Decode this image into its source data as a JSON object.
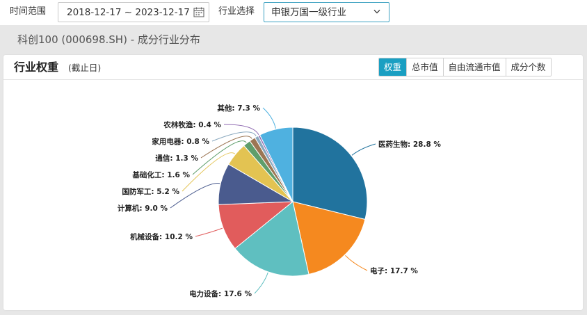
{
  "filters": {
    "time_label": "时间范围",
    "date_range": "2018-12-17 ~ 2023-12-17",
    "industry_label": "行业选择",
    "industry_value": "申银万国一级行业"
  },
  "section_title": "科创100 (000698.SH) - 成分行业分布",
  "card": {
    "title": "行业权重",
    "subtitle": "(截止日)",
    "tabs": [
      {
        "label": "权重",
        "active": true
      },
      {
        "label": "总市值",
        "active": false
      },
      {
        "label": "自由流通市值",
        "active": false
      },
      {
        "label": "成分个数",
        "active": false
      }
    ]
  },
  "chart_data": {
    "type": "pie",
    "slices": [
      {
        "name": "医药生物",
        "value": 28.8,
        "label": "医药生物: 28.8 %",
        "color": "#21739e"
      },
      {
        "name": "电子",
        "value": 17.7,
        "label": "电子: 17.7 %",
        "color": "#f5891f"
      },
      {
        "name": "电力设备",
        "value": 17.6,
        "label": "电力设备: 17.6 %",
        "color": "#5fbfc0"
      },
      {
        "name": "机械设备",
        "value": 10.2,
        "label": "机械设备: 10.2 %",
        "color": "#e15c5c"
      },
      {
        "name": "计算机",
        "value": 9.0,
        "label": "计算机: 9.0 %",
        "color": "#4a5b8e"
      },
      {
        "name": "国防军工",
        "value": 5.2,
        "label": "国防军工: 5.2 %",
        "color": "#e3c352"
      },
      {
        "name": "基础化工",
        "value": 1.6,
        "label": "基础化工: 1.6 %",
        "color": "#5f9e6b"
      },
      {
        "name": "通信",
        "value": 1.3,
        "label": "通信: 1.3 %",
        "color": "#9c7654"
      },
      {
        "name": "家用电器",
        "value": 0.8,
        "label": "家用电器: 0.8 %",
        "color": "#8aa9bf"
      },
      {
        "name": "农林牧渔",
        "value": 0.4,
        "label": "农林牧渔: 0.4 %",
        "color": "#8f6ab1"
      },
      {
        "name": "其他",
        "value": 7.3,
        "label": "其他: 7.3 %",
        "color": "#4fb1e0"
      }
    ],
    "legend": "none",
    "start_angle": "12 o'clock",
    "direction": "clockwise"
  }
}
